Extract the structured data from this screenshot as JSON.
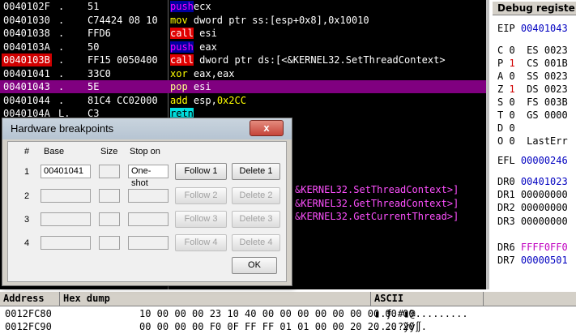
{
  "disasm": {
    "rows": [
      {
        "addr": "0040102F",
        "mark": ".",
        "hex": "51",
        "op": "push",
        "rest": "ecx",
        "op_style": "push"
      },
      {
        "addr": "00401030",
        "mark": ".",
        "hex": "C74424 08 10",
        "op": "mov",
        "rest": " dword ptr ss:[esp+0x8],0x10010",
        "op_style": "mov"
      },
      {
        "addr": "00401038",
        "mark": ".",
        "hex": "FFD6",
        "op": "call",
        "rest": " esi",
        "op_style": "call"
      },
      {
        "addr": "0040103A",
        "mark": ".",
        "hex": "50",
        "op": "push",
        "rest": " eax",
        "op_style": "push"
      },
      {
        "addr": "0040103B",
        "mark": ".",
        "hex": "FF15 0050400",
        "op": "call",
        "rest": " dword ptr ds:[<&KERNEL32.SetThreadContext>",
        "op_style": "call"
      },
      {
        "addr": "00401041",
        "mark": ".",
        "hex": "33C0",
        "op": "xor",
        "rest": " eax,eax",
        "op_style": "xor"
      },
      {
        "addr": "00401043",
        "mark": ".",
        "hex": "5E",
        "op": "pop",
        "rest": " esi",
        "op_style": "pop"
      },
      {
        "addr": "00401044",
        "mark": ".",
        "hex": "81C4 CC02000",
        "op": "add",
        "rest": " esp,",
        "imm": "0x2CC",
        "op_style": "add"
      },
      {
        "addr": "0040104A",
        "mark": "L.",
        "hex": "C3",
        "op": "retn",
        "rest": "",
        "op_style": "retn"
      }
    ],
    "lower": [
      "&KERNEL32.SetThreadContext>]",
      "&KERNEL32.GetThreadContext>]",
      "&KERNEL32.GetCurrentThread>]"
    ]
  },
  "registers": {
    "title": "Debug registe",
    "eip": {
      "name": "EIP",
      "value": "00401043"
    },
    "flags": [
      {
        "f": "C",
        "v": "0",
        "seg": "ES",
        "sv": "0023"
      },
      {
        "f": "P",
        "v": "1",
        "seg": "CS",
        "sv": "001B"
      },
      {
        "f": "A",
        "v": "0",
        "seg": "SS",
        "sv": "0023"
      },
      {
        "f": "Z",
        "v": "1",
        "seg": "DS",
        "sv": "0023"
      },
      {
        "f": "S",
        "v": "0",
        "seg": "FS",
        "sv": "003B"
      },
      {
        "f": "T",
        "v": "0",
        "seg": "GS",
        "sv": "0000"
      },
      {
        "f": "D",
        "v": "0",
        "seg": "",
        "sv": ""
      },
      {
        "f": "O",
        "v": "0",
        "seg": "LastErr",
        "sv": ""
      }
    ],
    "efl": {
      "name": "EFL",
      "value": "00000246"
    },
    "dr": [
      {
        "name": "DR0",
        "value": "00401023"
      },
      {
        "name": "DR1",
        "value": "00000000"
      },
      {
        "name": "DR2",
        "value": "00000000"
      },
      {
        "name": "DR3",
        "value": "00000000"
      },
      {
        "name": "DR6",
        "value": "FFFF0FF0"
      },
      {
        "name": "DR7",
        "value": "00000501"
      }
    ]
  },
  "dump": {
    "headers": {
      "address": "Address",
      "hex": "Hex dump",
      "ascii": "ASCII"
    },
    "rows": [
      {
        "addr": "0012FC80",
        "hex": "10 00 00 00 23 10 40 00 00 00 00 00 00 00 00 00",
        "ascii": "▮.ƒ.#▮@........."
      },
      {
        "addr": "0012FC90",
        "hex": "00 00 00 00 F0 0F FF FF 01 01 00 00 20 20 20 20",
        "ascii": "....?ÿÿ∬.    "
      }
    ]
  },
  "dialog": {
    "title": "Hardware breakpoints",
    "close": "x",
    "headers": {
      "num": "#",
      "base": "Base",
      "size": "Size",
      "stop": "Stop on"
    },
    "rows": [
      {
        "num": "1",
        "base": "00401041",
        "size": "",
        "stop": "One-shot",
        "follow": "Follow 1",
        "delete": "Delete 1",
        "enabled": true
      },
      {
        "num": "2",
        "base": "",
        "size": "",
        "stop": "",
        "follow": "Follow 2",
        "delete": "Delete 2",
        "enabled": false
      },
      {
        "num": "3",
        "base": "",
        "size": "",
        "stop": "",
        "follow": "Follow 3",
        "delete": "Delete 3",
        "enabled": false
      },
      {
        "num": "4",
        "base": "",
        "size": "",
        "stop": "",
        "follow": "Follow 4",
        "delete": "Delete 4",
        "enabled": false
      }
    ],
    "ok": "OK"
  }
}
